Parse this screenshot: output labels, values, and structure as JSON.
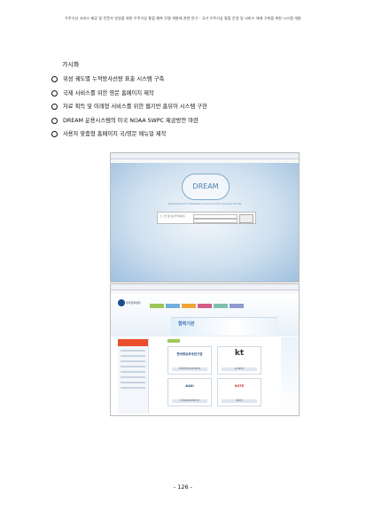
{
  "header": {
    "text": "우주기상 서비스 제공 및 전문가 양성을 위한 우주기상 통합 예측 모델 개발에 관한 연구 - 국가 우주기상 통합 운영 및 서비스 체계 구축을 위한 시스템 개발"
  },
  "section": {
    "title": "가시화"
  },
  "bullets": [
    "위성 궤도별 누적방사선량 표출 시스템 구축",
    "국제 서비스를 위한 영문 홈페이지 제작",
    "자료 획득 및 미래형 서비스를 위한 웹기반 홈뷰어 시스템 구현",
    "DREAM 운용시스템의 미국 NOAA SWPC 제공방안 마련",
    "사용자 맞춤형 홈페이지 국/영문 매뉴얼 제작"
  ],
  "screenshot1": {
    "logo_text": "DREAM",
    "tagline": "Development of Radiation Environment Analysis Model",
    "login_label": "로그인 정보를 입력하세요"
  },
  "screenshot2": {
    "site_logo": "우주전파센터",
    "banner_title": "협력기관",
    "cards": [
      {
        "name": "한국항공우주연구원",
        "caption": "한국항공우주연구원 바로가기"
      },
      {
        "name": "kt",
        "caption": "KT 바로가기"
      },
      {
        "name": "KASI",
        "caption": "한국천문연구원 바로가기"
      },
      {
        "name": "KUTE",
        "caption": "바로가기"
      }
    ],
    "colors": {
      "nav": [
        "#9bc65a",
        "#6fb0d8",
        "#f0a43a",
        "#d35d8a",
        "#7ec0b0",
        "#8f9ad0"
      ],
      "side_header": "#e94f2c",
      "accent": "#9fc75b"
    }
  },
  "page_number": "- 126 -"
}
